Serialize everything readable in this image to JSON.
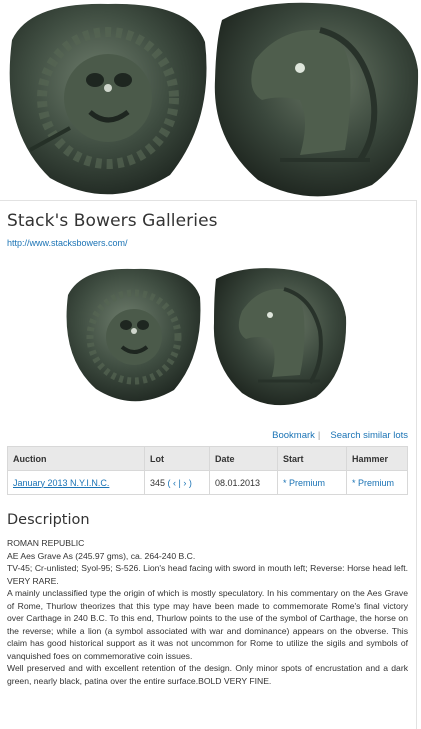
{
  "gallery": {
    "name": "Stack's Bowers Galleries",
    "url": "http://www.stacksbowers.com/"
  },
  "images": {
    "obverse": "lion-head-coin",
    "reverse": "horse-head-coin"
  },
  "actions": {
    "bookmark": "Bookmark",
    "separator": "|",
    "search_similar": "Search similar lots"
  },
  "table": {
    "headers": [
      "Auction",
      "Lot",
      "Date",
      "Start",
      "Hammer"
    ],
    "row": {
      "auction": "January 2013 N.Y.I.N.C.",
      "lot": "345",
      "lot_nav": "( ‹ | › )",
      "date": "08.01.2013",
      "start": "* Premium",
      "hammer": "* Premium"
    }
  },
  "description": {
    "title": "Description",
    "lines": [
      "ROMAN REPUBLIC",
      "AE Aes Grave As (245.97 gms), ca. 264-240 B.C.",
      "TV-45; Cr-unlisted; Syol-95; S-526. Lion's head facing with sword in mouth left; Reverse: Horse head left. VERY RARE.",
      "A mainly unclassified type the origin of which is mostly speculatory. In his commentary on the Aes Grave of Rome, Thurlow theorizes that this type may have been made to commemorate Rome's final victory over Carthage in 240 B.C. To this end, Thurlow points to the use of the symbol of Carthage, the horse on the reverse; while a lion (a symbol associated with war and dominance) appears on the obverse. This claim has good historical support as it was not uncommon for Rome to utilize the sigils and symbols of vanquished foes on commemorative coin issues.",
      "Well preserved and with excellent retention of the design. Only minor spots of encrustation and a dark green, nearly black, patina over the entire surface.BOLD VERY FINE."
    ]
  },
  "colors": {
    "link": "#1a73b5",
    "header_bg": "#e9e9e9",
    "patina_dark": "#2d3a30",
    "patina_light": "#6e7d6c"
  }
}
